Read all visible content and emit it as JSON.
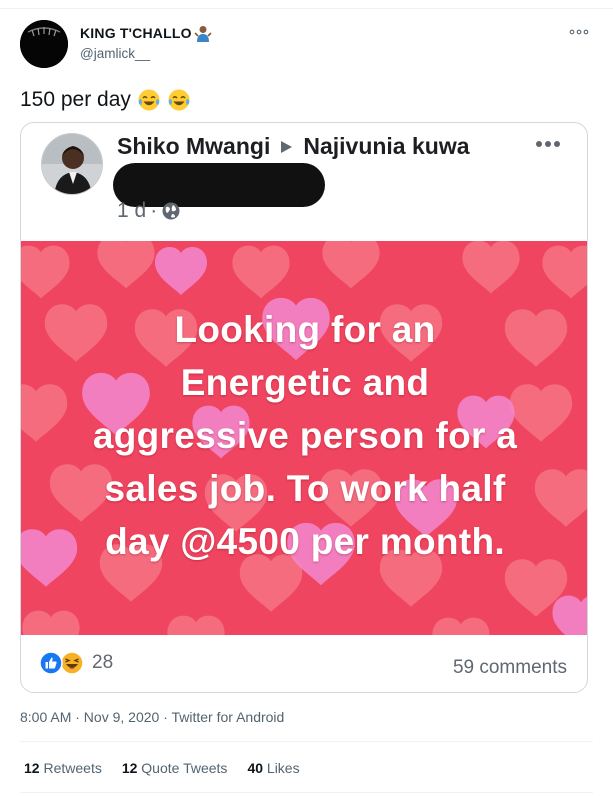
{
  "tweet": {
    "author": {
      "display_name": "KING T'CHALLO",
      "handle": "@jamlick__",
      "name_emoji": "person-shrugging-emoji"
    },
    "text": "150 per day",
    "text_emojis": [
      "tears-of-joy-emoji",
      "tears-of-joy-emoji"
    ],
    "more_icon": "more-horizontal-icon",
    "timestamp": "8:00 AM · Nov 9, 2020 · Twitter for Android",
    "stats": {
      "retweets_count": "12",
      "retweets_label": "Retweets",
      "quote_count": "12",
      "quote_label": "Quote Tweets",
      "likes_count": "40",
      "likes_label": "Likes"
    }
  },
  "facebook_post": {
    "author": "Shiko Mwangi",
    "group": "Najivunia kuwa",
    "time": "1 d",
    "privacy_icon": "globe-icon",
    "banner_lines": [
      "Looking for an",
      "Energetic and",
      "aggressive person for a",
      "sales job. To work half",
      "day @4500 per month."
    ],
    "reactions": {
      "icons": [
        "like-reaction-icon",
        "haha-reaction-icon"
      ],
      "count": "28"
    },
    "comments": "59 comments",
    "colors": {
      "banner_bg": "#f04560",
      "heart_light": "#f77a8a",
      "heart_pink": "#f28ad0"
    }
  }
}
